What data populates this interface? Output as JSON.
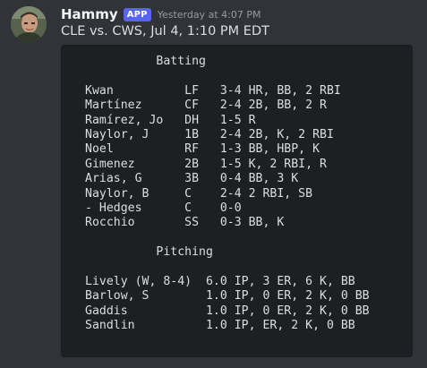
{
  "message": {
    "username": "Hammy",
    "badge": "APP",
    "timestamp": "Yesterday at 4:07 PM",
    "content": "CLE vs. CWS, Jul 4, 1:10 PM EDT"
  },
  "code_lines": [
    "          Batting",
    "",
    "Kwan          LF   3-4 HR, BB, 2 RBI",
    "Martínez      CF   2-4 2B, BB, 2 R",
    "Ramírez, Jo   DH   1-5 R",
    "Naylor, J     1B   2-4 2B, K, 2 RBI",
    "Noel          RF   1-3 BB, HBP, K",
    "Gimenez       2B   1-5 K, 2 RBI, R",
    "Arias, G      3B   0-4 BB, 3 K",
    "Naylor, B     C    2-4 2 RBI, SB",
    "- Hedges      C    0-0",
    "Rocchio       SS   0-3 BB, K",
    "",
    "          Pitching",
    "",
    "Lively (W, 8-4)  6.0 IP, 3 ER, 6 K, BB",
    "Barlow, S        1.0 IP, 0 ER, 2 K, 0 BB",
    "Gaddis           1.0 IP, 0 ER, 2 K, 0 BB",
    "Sandlin          1.0 IP, ER, 2 K, 0 BB"
  ]
}
